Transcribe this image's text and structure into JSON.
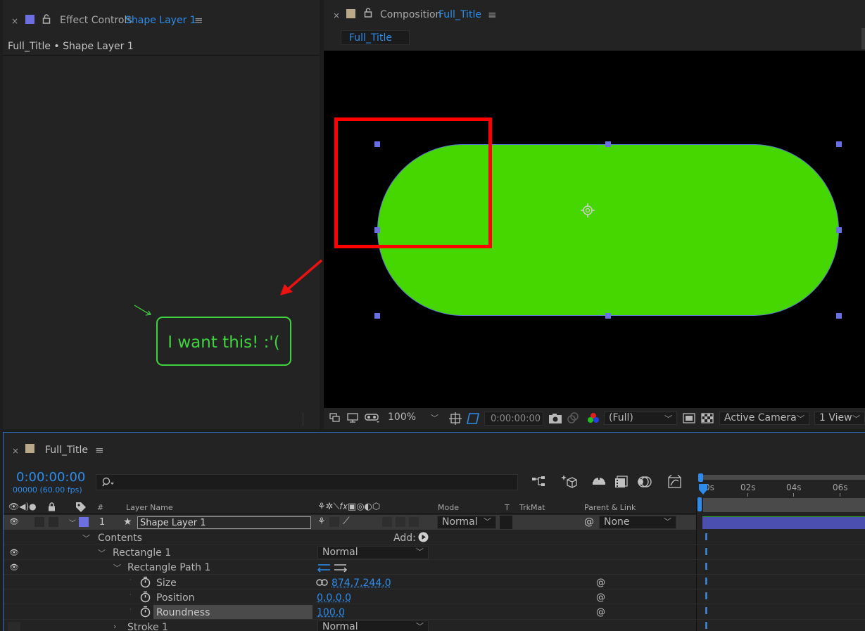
{
  "effect_panel": {
    "close": "×",
    "tab_prefix": "Effect Controls",
    "tab_layer": "Shape Layer 1",
    "breadcrumb": "Full_Title • Shape Layer 1"
  },
  "annotation": {
    "callout_text": "I want this! :'("
  },
  "comp_panel": {
    "close": "×",
    "tab_prefix": "Composition",
    "tab_comp": "Full_Title",
    "comp_tab_button": "Full_Title",
    "toolbar": {
      "zoom": "100%",
      "timecode": "0:00:00:00",
      "resolution": "(Full)",
      "camera": "Active Camera",
      "views": "1 View"
    }
  },
  "timeline": {
    "close": "×",
    "tab_title": "Full_Title",
    "timecode": "0:00:00:00",
    "frames": "00000 (60.00 fps)",
    "search_placeholder": "",
    "ruler": [
      "0s",
      "02s",
      "04s",
      "06s"
    ],
    "headers": {
      "num": "#",
      "layer_name": "Layer Name",
      "mode": "Mode",
      "t": "T",
      "trkmat": "TrkMat",
      "parent": "Parent & Link"
    },
    "layer": {
      "index": "1",
      "name": "Shape Layer 1",
      "mode": "Normal",
      "parent": "None"
    },
    "contents": {
      "label": "Contents",
      "add_label": "Add:"
    },
    "rectangle": {
      "label": "Rectangle 1",
      "mode": "Normal"
    },
    "rect_path": {
      "label": "Rectangle Path 1"
    },
    "size": {
      "label": "Size",
      "value": "874,7,244,0"
    },
    "position": {
      "label": "Position",
      "value": "0,0,0,0"
    },
    "roundness": {
      "label": "Roundness",
      "value": "100,0"
    },
    "stroke": {
      "label": "Stroke 1",
      "mode": "Normal"
    }
  },
  "colors": {
    "accent_blue": "#2d8ceb",
    "shape_green": "#46d600",
    "highlight_red": "#ff0000",
    "callout_green": "#3fd43f",
    "layer_label": "#6b6fe0"
  }
}
